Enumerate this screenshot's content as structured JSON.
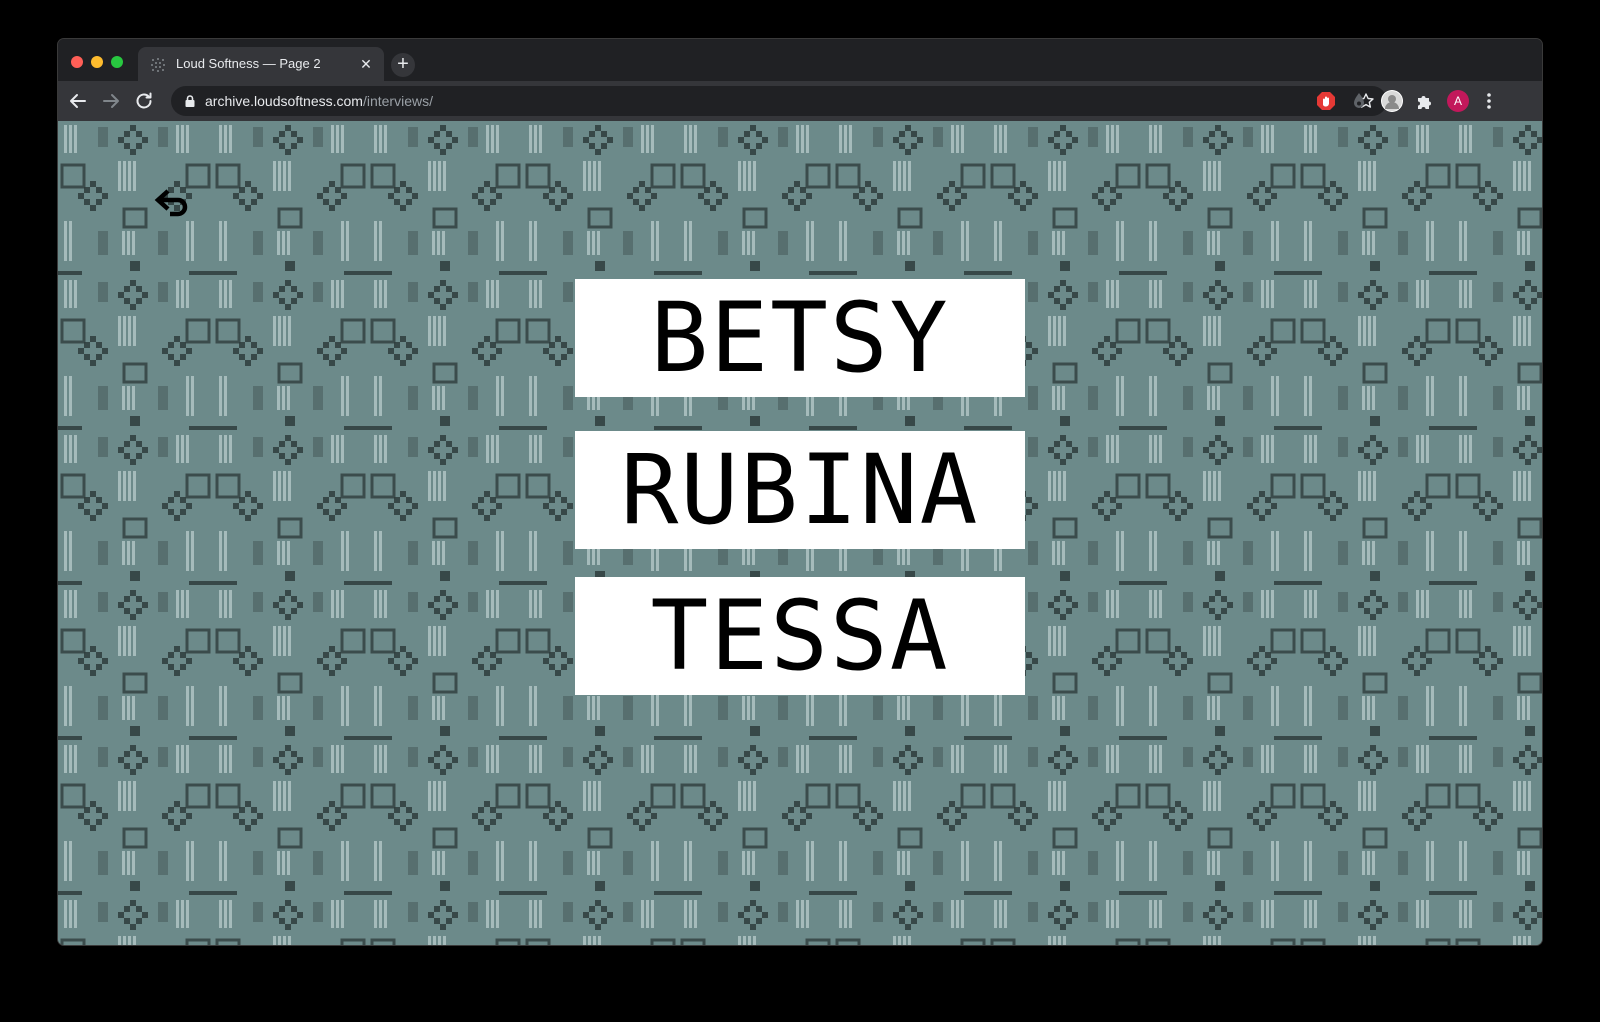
{
  "browser": {
    "tab": {
      "title": "Loud Softness — Page 2",
      "close_glyph": "✕",
      "favicon": "dotted-grid-icon"
    },
    "new_tab_glyph": "+",
    "address": {
      "domain": "archive.loudsoftness.com",
      "path": "/interviews/"
    },
    "profile_initial": "A",
    "icons": {
      "back": "back-arrow-icon",
      "forward": "forward-arrow-icon",
      "reload": "reload-icon",
      "lock": "lock-icon",
      "bookmark": "star-icon",
      "extensions": "puzzle-icon",
      "menu": "kebab-menu-icon"
    }
  },
  "page": {
    "background_color": "#6c8a8a",
    "back_icon": "return-arrow-icon",
    "names": [
      "BETSY",
      "RUBINA",
      "TESSA"
    ]
  }
}
